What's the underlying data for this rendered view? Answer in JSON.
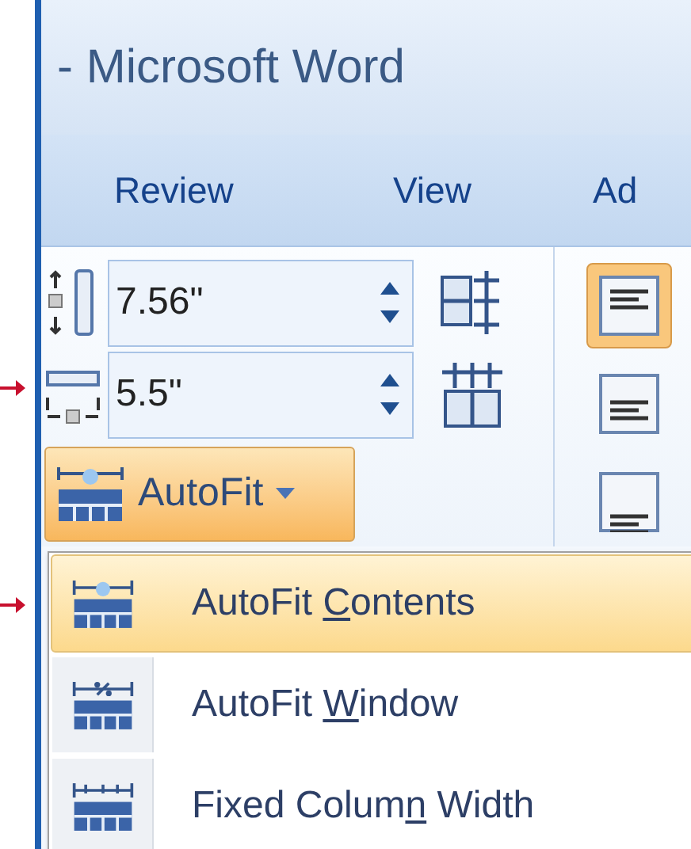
{
  "window": {
    "title": "- Microsoft Word"
  },
  "tabs": [
    {
      "label": "Review",
      "selected": false
    },
    {
      "label": "View",
      "selected": false
    },
    {
      "label": "Ad",
      "selected": false
    }
  ],
  "cell_size": {
    "height": {
      "value": "7.56\""
    },
    "width": {
      "value": "5.5\""
    },
    "autofit_button": {
      "label": "AutoFit",
      "expanded": true
    }
  },
  "alignment_buttons": [
    {
      "selected": true
    },
    {
      "selected": false
    },
    {
      "selected": false
    }
  ],
  "autofit_menu": [
    {
      "before": "AutoFit ",
      "key": "C",
      "after": "ontents",
      "selected": true
    },
    {
      "before": "AutoFit ",
      "key": "W",
      "after": "indow",
      "selected": false
    },
    {
      "before": "Fixed Colum",
      "key": "n",
      "after": " Width",
      "selected": false
    }
  ]
}
